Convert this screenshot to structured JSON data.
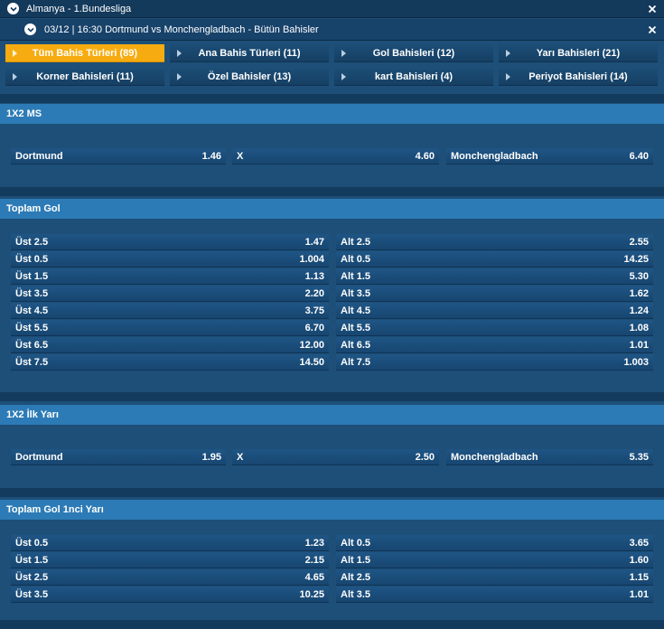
{
  "header": {
    "league": "Almanya - 1.Bundesliga"
  },
  "match_bar": {
    "title": "03/12 | 16:30 Dortmund vs Monchengladbach - Bütün Bahisler"
  },
  "tabs": [
    {
      "label": "Tüm Bahis Türleri (89)"
    },
    {
      "label": "Ana Bahis Türleri (11)"
    },
    {
      "label": "Gol Bahisleri (12)"
    },
    {
      "label": "Yarı Bahisleri (21)"
    },
    {
      "label": "Korner Bahisleri (11)"
    },
    {
      "label": "Özel Bahisler (13)"
    },
    {
      "label": "kart Bahisleri (4)"
    },
    {
      "label": "Periyot Bahisleri (14)"
    }
  ],
  "ms": {
    "title": "1X2 MS",
    "cells": [
      {
        "label": "Dortmund",
        "odd": "1.46"
      },
      {
        "label": "X",
        "odd": "4.60"
      },
      {
        "label": "Monchengladbach",
        "odd": "6.40"
      }
    ]
  },
  "total_goals": {
    "title": "Toplam Gol",
    "rows": [
      {
        "over": "Üst 2.5",
        "over_odd": "1.47",
        "under": "Alt 2.5",
        "under_odd": "2.55"
      },
      {
        "over": "Üst 0.5",
        "over_odd": "1.004",
        "under": "Alt 0.5",
        "under_odd": "14.25"
      },
      {
        "over": "Üst 1.5",
        "over_odd": "1.13",
        "under": "Alt 1.5",
        "under_odd": "5.30"
      },
      {
        "over": "Üst 3.5",
        "over_odd": "2.20",
        "under": "Alt 3.5",
        "under_odd": "1.62"
      },
      {
        "over": "Üst 4.5",
        "over_odd": "3.75",
        "under": "Alt 4.5",
        "under_odd": "1.24"
      },
      {
        "over": "Üst 5.5",
        "over_odd": "6.70",
        "under": "Alt 5.5",
        "under_odd": "1.08"
      },
      {
        "over": "Üst 6.5",
        "over_odd": "12.00",
        "under": "Alt 6.5",
        "under_odd": "1.01"
      },
      {
        "over": "Üst 7.5",
        "over_odd": "14.50",
        "under": "Alt 7.5",
        "under_odd": "1.003"
      }
    ]
  },
  "ht": {
    "title": "1X2 İlk Yarı",
    "cells": [
      {
        "label": "Dortmund",
        "odd": "1.95"
      },
      {
        "label": "X",
        "odd": "2.50"
      },
      {
        "label": "Monchengladbach",
        "odd": "5.35"
      }
    ]
  },
  "ht_goals": {
    "title": "Toplam Gol 1nci Yarı",
    "rows": [
      {
        "over": "Üst 0.5",
        "over_odd": "1.23",
        "under": "Alt 0.5",
        "under_odd": "3.65"
      },
      {
        "over": "Üst 1.5",
        "over_odd": "2.15",
        "under": "Alt 1.5",
        "under_odd": "1.60"
      },
      {
        "over": "Üst 2.5",
        "over_odd": "4.65",
        "under": "Alt 2.5",
        "under_odd": "1.15"
      },
      {
        "over": "Üst 3.5",
        "over_odd": "10.25",
        "under": "Alt 3.5",
        "under_odd": "1.01"
      }
    ]
  }
}
